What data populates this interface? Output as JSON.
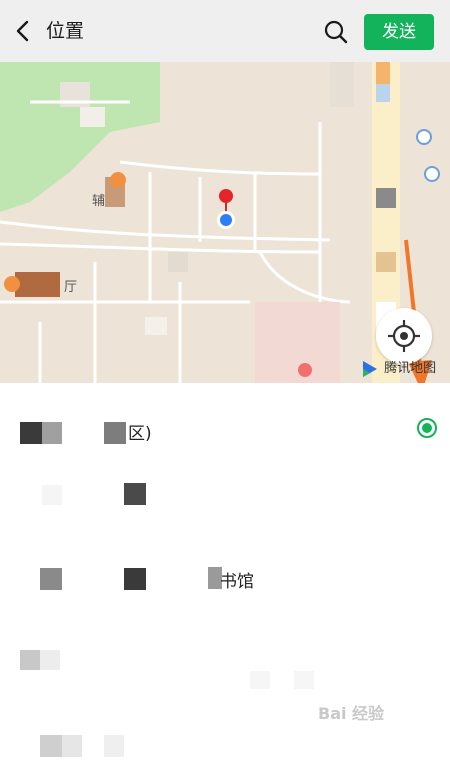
{
  "header": {
    "title": "位置",
    "send_label": "发送",
    "back_icon": "chevron-left-icon",
    "search_icon": "search-icon"
  },
  "map": {
    "provider_label": "腾讯地图",
    "poi_labels": [
      "辅",
      "厅"
    ],
    "icons": [
      "location-pin-icon",
      "current-location-dot-icon",
      "locate-icon"
    ]
  },
  "locations": [
    {
      "text": "区)",
      "selected": true
    },
    {
      "text": "",
      "selected": false
    },
    {
      "text": "书馆",
      "selected": false
    },
    {
      "text": "",
      "selected": false
    },
    {
      "text": "",
      "selected": false
    }
  ],
  "watermark": "Bai 经验",
  "colors": {
    "accent": "#13b35b",
    "arrow": "#f0762a"
  }
}
